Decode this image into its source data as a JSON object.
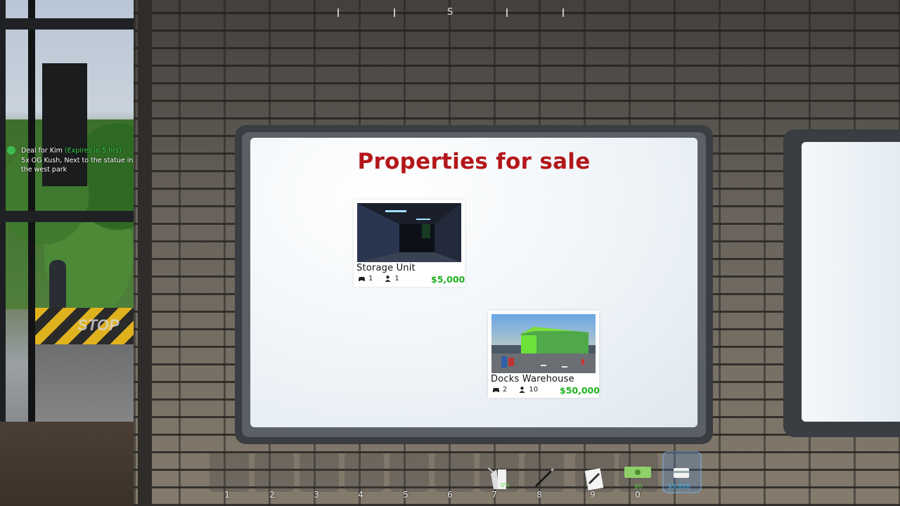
{
  "hud": {
    "compass": {
      "heading_letter": "S"
    },
    "quest": {
      "icon": "deal-icon",
      "title": "Deal for Kim",
      "expires": "(Expires in 5 hrs)",
      "details": "5x OG Kush, Next to the statue in the west park"
    },
    "hotbar": {
      "slot_numbers": [
        "1",
        "2",
        "3",
        "4",
        "5",
        "6",
        "7",
        "8",
        "9",
        "0"
      ],
      "slot7_percent": "0%",
      "cash_amount": "$0",
      "bank_amount": "$5,826"
    }
  },
  "environment": {
    "stop_sign_text": "STOP"
  },
  "board": {
    "title": "Properties for sale",
    "listings": [
      {
        "name": "Storage Unit",
        "vehicles": "1",
        "employees": "1",
        "price": "$5,000"
      },
      {
        "name": "Docks Warehouse",
        "vehicles": "2",
        "employees": "10",
        "price": "$50,000"
      }
    ]
  },
  "colors": {
    "title_red": "#b3171b",
    "price_green": "#1fb21f",
    "cash_green": "#59d43c",
    "bank_blue": "#3fb3ee"
  }
}
